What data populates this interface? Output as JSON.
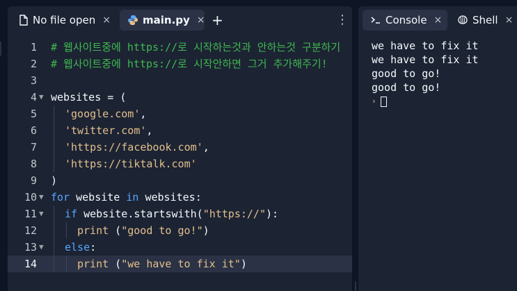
{
  "editor": {
    "tabs": [
      {
        "label": "No file open",
        "close": "×",
        "icon": "file-icon"
      },
      {
        "label": "main.py",
        "close": "×",
        "icon": "python-icon"
      }
    ],
    "add_tab": "+",
    "menu": "⋮",
    "current_line": 14,
    "lines": [
      {
        "n": "1",
        "fold": false,
        "indent": 0,
        "tokens": [
          {
            "t": "cm",
            "v": "# 웹사이트중에 https://로 시작하는것과 안하는것 구분하기"
          }
        ]
      },
      {
        "n": "2",
        "fold": false,
        "indent": 0,
        "tokens": [
          {
            "t": "cm",
            "v": "# 웹사이트중에 https://로 시작안하면 그거 추가해주기!"
          }
        ]
      },
      {
        "n": "3",
        "fold": false,
        "indent": 0,
        "tokens": []
      },
      {
        "n": "4",
        "fold": true,
        "indent": 0,
        "tokens": [
          {
            "t": "id",
            "v": "websites"
          },
          {
            "t": "pu",
            "v": " = ("
          }
        ]
      },
      {
        "n": "5",
        "fold": false,
        "indent": 1,
        "tokens": [
          {
            "t": "str",
            "v": "'google.com'"
          },
          {
            "t": "pu",
            "v": ","
          }
        ]
      },
      {
        "n": "6",
        "fold": false,
        "indent": 1,
        "tokens": [
          {
            "t": "str",
            "v": "'twitter.com'"
          },
          {
            "t": "pu",
            "v": ","
          }
        ]
      },
      {
        "n": "7",
        "fold": false,
        "indent": 1,
        "tokens": [
          {
            "t": "str",
            "v": "'https://facebook.com'"
          },
          {
            "t": "pu",
            "v": ","
          }
        ]
      },
      {
        "n": "8",
        "fold": false,
        "indent": 1,
        "tokens": [
          {
            "t": "str",
            "v": "'https://tiktalk.com'"
          }
        ]
      },
      {
        "n": "9",
        "fold": false,
        "indent": 0,
        "tokens": [
          {
            "t": "pu",
            "v": ")"
          }
        ]
      },
      {
        "n": "10",
        "fold": true,
        "indent": 0,
        "tokens": [
          {
            "t": "kw",
            "v": "for"
          },
          {
            "t": "id",
            "v": " website "
          },
          {
            "t": "kw",
            "v": "in"
          },
          {
            "t": "id",
            "v": " websites"
          },
          {
            "t": "pu",
            "v": ":"
          }
        ]
      },
      {
        "n": "11",
        "fold": true,
        "indent": 1,
        "tokens": [
          {
            "t": "kw",
            "v": "if"
          },
          {
            "t": "id",
            "v": " website"
          },
          {
            "t": "pu",
            "v": "."
          },
          {
            "t": "fn",
            "v": "startswith"
          },
          {
            "t": "pu",
            "v": "("
          },
          {
            "t": "str",
            "v": "\"https://\""
          },
          {
            "t": "pu",
            "v": "):"
          }
        ]
      },
      {
        "n": "12",
        "fold": false,
        "indent": 2,
        "tokens": [
          {
            "t": "bi",
            "v": "print"
          },
          {
            "t": "pu",
            "v": " ("
          },
          {
            "t": "str",
            "v": "\"good to go!\""
          },
          {
            "t": "pu",
            "v": ")"
          }
        ]
      },
      {
        "n": "13",
        "fold": true,
        "indent": 1,
        "tokens": [
          {
            "t": "kw",
            "v": "else"
          },
          {
            "t": "pu",
            "v": ":"
          }
        ]
      },
      {
        "n": "14",
        "fold": false,
        "indent": 2,
        "tokens": [
          {
            "t": "bi",
            "v": "print"
          },
          {
            "t": "pu",
            "v": " ("
          },
          {
            "t": "str",
            "v": "\"we have to fix it\""
          },
          {
            "t": "pu",
            "v": ")"
          }
        ]
      }
    ]
  },
  "console": {
    "tabs": [
      {
        "label": "Console",
        "close": "×",
        "icon": "terminal-icon"
      },
      {
        "label": "Shell",
        "close": "×",
        "icon": "shell-icon"
      }
    ],
    "output": [
      "we have to fix it",
      "we have to fix it",
      "good to go!",
      "good to go!"
    ],
    "prompt": "›"
  },
  "colors": {
    "background": "#0e1525",
    "panel": "#1c2333",
    "active_tab": "#2b3245",
    "comment": "#3fb950",
    "keyword": "#58a6ff",
    "string": "#e2c08d"
  }
}
